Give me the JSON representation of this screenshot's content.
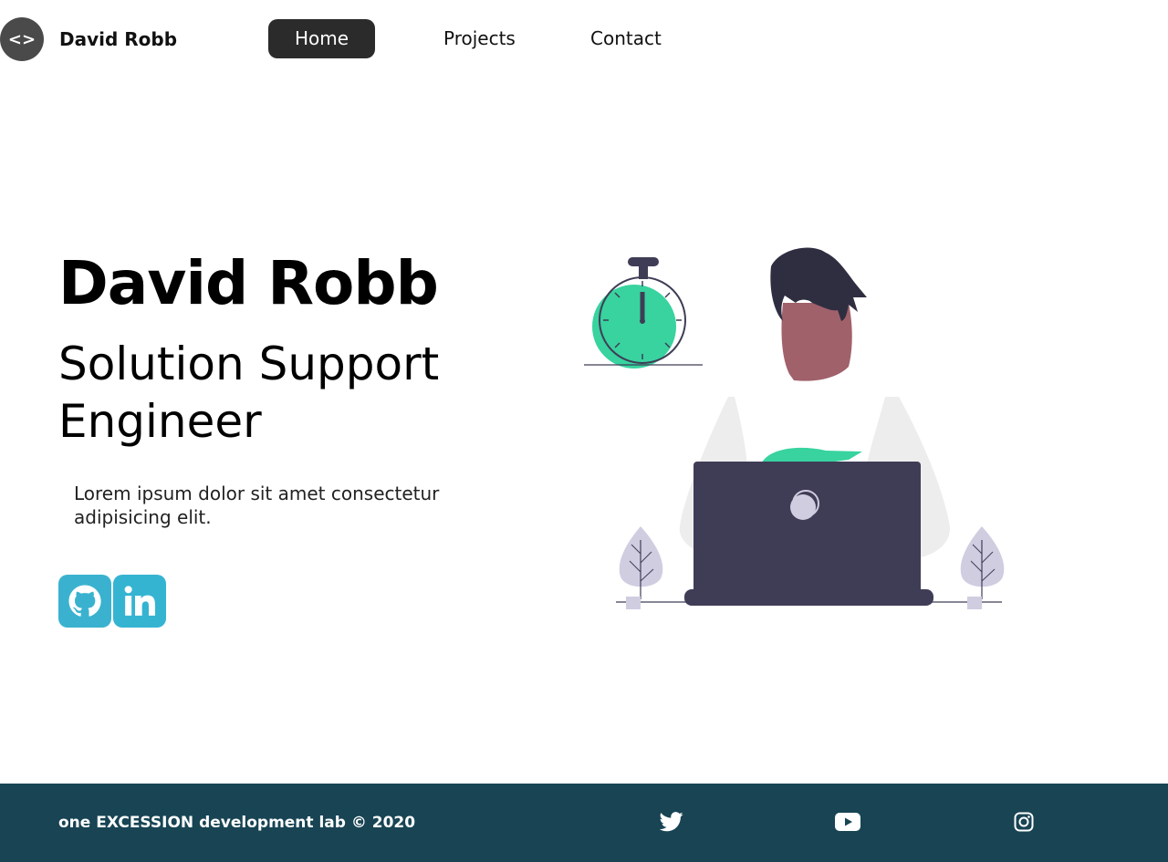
{
  "header": {
    "logo_glyph": "<>",
    "brand": "David Robb",
    "nav": [
      {
        "label": "Home",
        "active": true
      },
      {
        "label": "Projects",
        "active": false
      },
      {
        "label": "Contact",
        "active": false
      }
    ]
  },
  "hero": {
    "name": "David Robb",
    "role": "Solution Support Engineer",
    "blurb": "Lorem ipsum dolor sit amet consectetur adipisicing elit.",
    "social": [
      {
        "icon": "github-icon"
      },
      {
        "icon": "linkedin-icon"
      }
    ]
  },
  "footer": {
    "copyright": "one EXCESSION development lab © 2020",
    "icons": [
      "twitter-icon",
      "youtube-icon",
      "instagram-icon"
    ]
  },
  "colors": {
    "accent_green": "#38d39f",
    "footer_bg": "#184454",
    "social_bg": "#35b4d2",
    "nav_active_bg": "#2b2b2b"
  }
}
